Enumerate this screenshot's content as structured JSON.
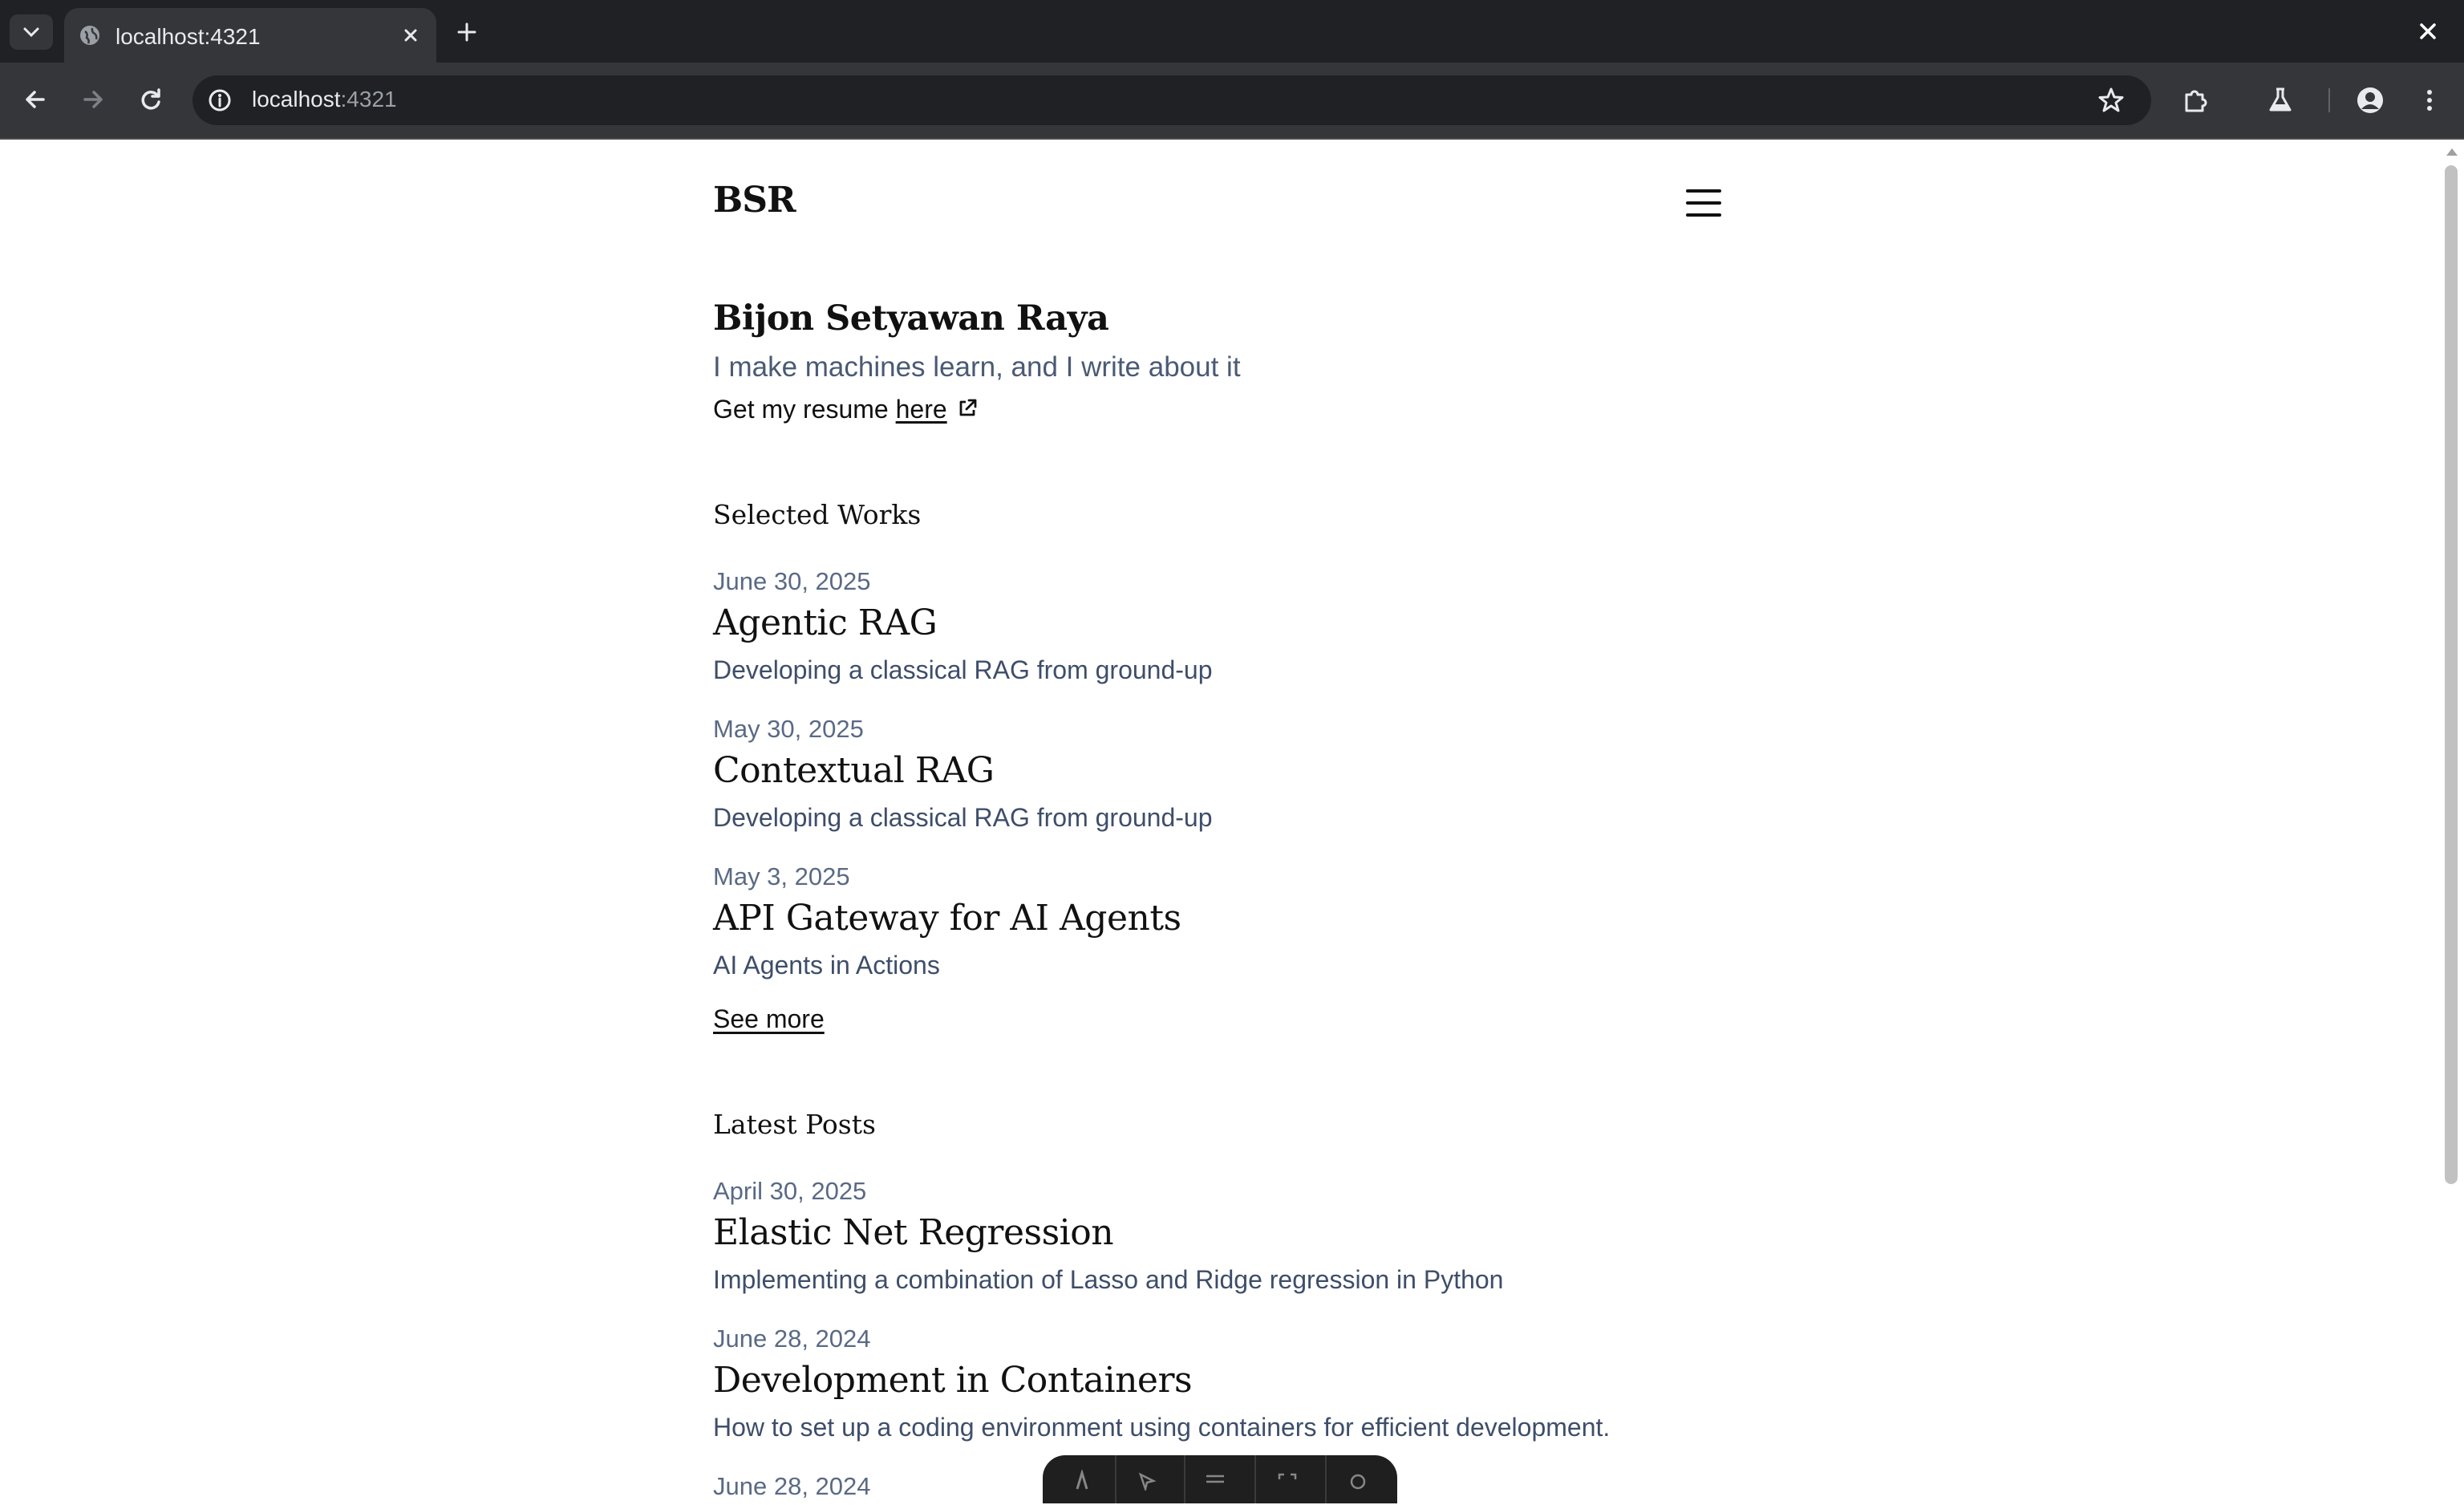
{
  "browser": {
    "tab_title": "localhost:4321",
    "url_host": "localhost",
    "url_port": ":4321"
  },
  "site": {
    "logo": "BSR",
    "name": "Bijon Setyawan Raya",
    "tagline": "I make machines learn, and I write about it",
    "resume_prefix": "Get my resume ",
    "resume_link": "here"
  },
  "selected_works": {
    "title": "Selected Works",
    "items": [
      {
        "date": "June 30, 2025",
        "title": "Agentic RAG",
        "description": "Developing a classical RAG from ground-up"
      },
      {
        "date": "May 30, 2025",
        "title": "Contextual RAG",
        "description": "Developing a classical RAG from ground-up"
      },
      {
        "date": "May 3, 2025",
        "title": "API Gateway for AI Agents",
        "description": "AI Agents in Actions"
      }
    ],
    "see_more": "See more"
  },
  "latest_posts": {
    "title": "Latest Posts",
    "items": [
      {
        "date": "April 30, 2025",
        "title": "Elastic Net Regression",
        "description": "Implementing a combination of Lasso and Ridge regression in Python"
      },
      {
        "date": "June 28, 2024",
        "title": "Development in Containers",
        "description": "How to set up a coding environment using containers for efficient development."
      },
      {
        "date": "June 28, 2024"
      }
    ]
  }
}
